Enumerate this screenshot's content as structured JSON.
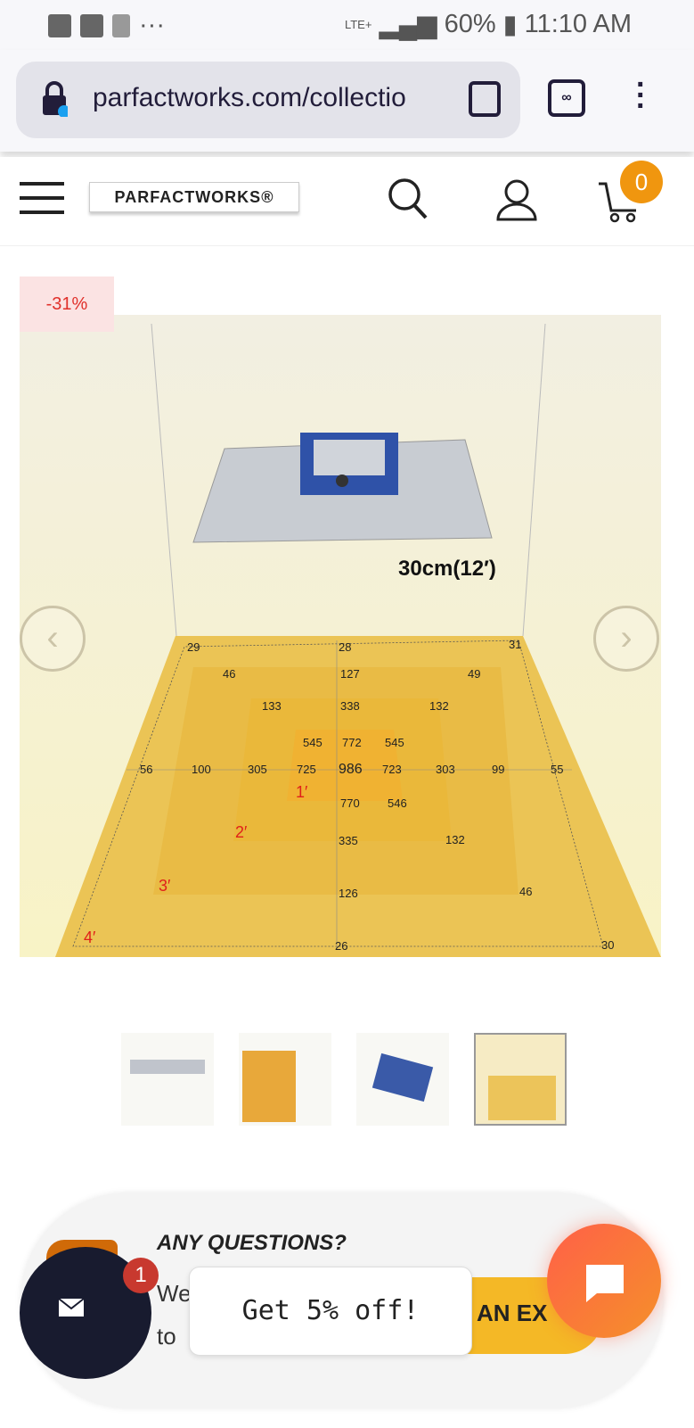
{
  "status": {
    "signal": "LTE+",
    "battery": "60%",
    "time": "11:10 AM",
    "more": "···"
  },
  "browser": {
    "url": "parfactworks.com/collectio",
    "tab_count": "∞"
  },
  "header": {
    "logo": "PARFACTWORKS®",
    "cart_count": "0",
    "icons": [
      "menu-icon",
      "search-icon",
      "user-icon",
      "cart-icon"
    ]
  },
  "product": {
    "discount": "-31%",
    "height_label": "30cm(12′)",
    "ppfd_values": [
      "29",
      "28",
      "31",
      "46",
      "127",
      "49",
      "133",
      "338",
      "132",
      "545",
      "772",
      "545",
      "56",
      "100",
      "305",
      "725",
      "986",
      "723",
      "303",
      "99",
      "55",
      "770",
      "546",
      "335",
      "132",
      "126",
      "46",
      "26",
      "30"
    ],
    "distance_labels": [
      "1′",
      "2′",
      "3′",
      "4′"
    ],
    "thumbnails": [
      "HB1500 hanging",
      "HB1500 full spectrum",
      "HB1500 size",
      "PPFD map"
    ]
  },
  "chat": {
    "title": "ANY QUESTIONS?",
    "line1": "We",
    "line2": "to",
    "button": "AN EX",
    "notif_count": "1",
    "popup": "Get 5% off!"
  },
  "colors": {
    "accent": "#f0960f",
    "discount": "#e0302a",
    "chat": "#ff6048",
    "mail": "#181b2f"
  }
}
